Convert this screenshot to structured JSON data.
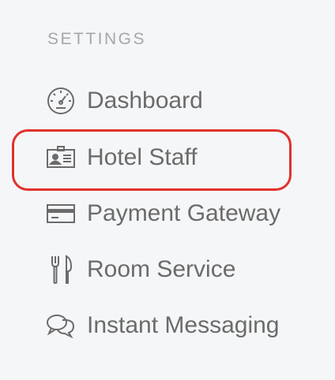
{
  "section": {
    "title": "SETTINGS"
  },
  "menu": {
    "items": [
      {
        "label": "Dashboard",
        "icon": "speedometer-icon"
      },
      {
        "label": "Hotel Staff",
        "icon": "id-card-icon"
      },
      {
        "label": "Payment Gateway",
        "icon": "credit-card-icon"
      },
      {
        "label": "Room Service",
        "icon": "fork-knife-icon"
      },
      {
        "label": "Instant Messaging",
        "icon": "chat-bubbles-icon"
      }
    ],
    "highlighted_item": "Hotel Staff"
  },
  "colors": {
    "background": "#f5f6f8",
    "text": "#6b6b6b",
    "section_title": "#a4a7ab",
    "highlight_border": "#e0312c"
  }
}
